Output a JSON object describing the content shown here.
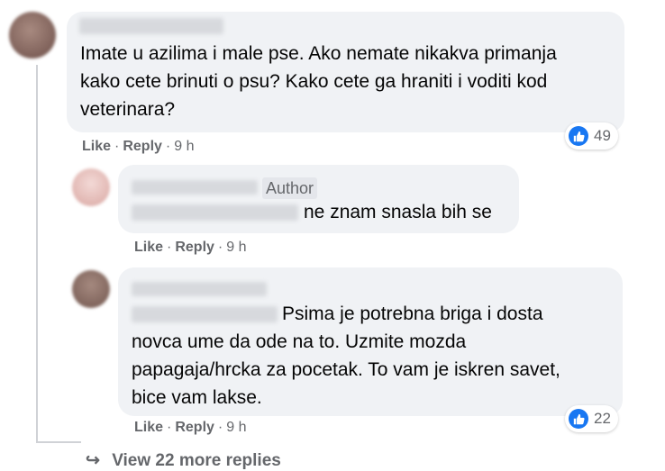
{
  "comments": [
    {
      "text": "Imate u azilima i male pse. Ako nemate nikakva primanja\nkako cete brinuti o psu? Kako cete ga hraniti i voditi kod\nveterinara?",
      "reactions": "49",
      "like": "Like",
      "reply": "Reply",
      "time": "9 h"
    },
    {
      "author_badge": "Author",
      "text": "ne znam snasla bih se",
      "like": "Like",
      "reply": "Reply",
      "time": "9 h"
    },
    {
      "text": "Psima je potrebna briga i dosta\nnovca ume da ode na to. Uzmite mozda\npapagaja/hrcka za pocetak. To vam je iskren savet,\nbice vam lakse.",
      "reactions": "22",
      "like": "Like",
      "reply": "Reply",
      "time": "9 h"
    }
  ],
  "view_more": "View 22 more replies",
  "colors": {
    "bubble": "#f0f2f5",
    "meta_text": "#65676b",
    "like_blue": "#1877f2"
  }
}
